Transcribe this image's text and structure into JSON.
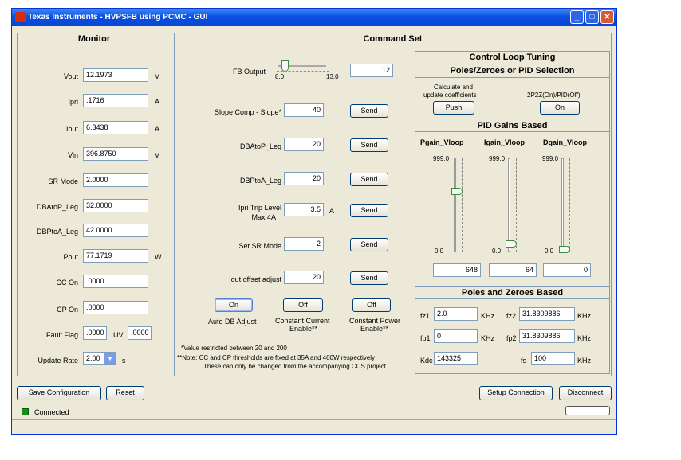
{
  "window": {
    "title": "Texas Instruments - HVPSFB using PCMC - GUI"
  },
  "monitor": {
    "title": "Monitor",
    "rows": [
      {
        "label": "Vout",
        "value": "12.1973",
        "unit": "V"
      },
      {
        "label": "Ipri",
        "value": ".1716",
        "unit": "A"
      },
      {
        "label": "Iout",
        "value": "6.3438",
        "unit": "A"
      },
      {
        "label": "Vin",
        "value": "396.8750",
        "unit": "V"
      },
      {
        "label": "SR Mode",
        "value": "2.0000",
        "unit": ""
      },
      {
        "label": "DBAtoP_Leg",
        "value": "32.0000",
        "unit": ""
      },
      {
        "label": "DBPtoA_Leg",
        "value": "42.0000",
        "unit": ""
      },
      {
        "label": "Pout",
        "value": "77.1719",
        "unit": "W"
      },
      {
        "label": "CC On",
        "value": ".0000",
        "unit": ""
      },
      {
        "label": "CP On",
        "value": ".0000",
        "unit": ""
      }
    ],
    "fault_flag": {
      "label": "Fault Flag",
      "value": ".0000",
      "uv_label": "UV",
      "uv_value": ".0000"
    },
    "update_rate": {
      "label": "Update Rate",
      "value": "2.00",
      "unit": "s"
    }
  },
  "command_set": {
    "title": "Command Set",
    "fb_output": {
      "label": "FB Output",
      "min": "8.0",
      "max": "13.0",
      "value": "12"
    },
    "slope_comp": {
      "label": "Slope Comp - Slope*",
      "value": "40",
      "button": "Send"
    },
    "dbatop_leg": {
      "label": "DBAtoP_Leg",
      "value": "20",
      "button": "Send"
    },
    "dbptoa_leg": {
      "label": "DBPtoA_Leg",
      "value": "20",
      "button": "Send"
    },
    "ipri_trip": {
      "label1": "Ipri Trip Level",
      "label2": "Max 4A",
      "value": "3.5",
      "unit": "A",
      "button": "Send"
    },
    "sr_mode": {
      "label": "Set SR Mode",
      "value": "2",
      "button": "Send"
    },
    "iout_offset": {
      "label": "Iout offset adjust",
      "value": "20",
      "button": "Send"
    },
    "toggles": [
      {
        "state": "On",
        "label1": "Auto DB Adjust",
        "label2": ""
      },
      {
        "state": "Off",
        "label1": "Constant Current",
        "label2": "Enable**"
      },
      {
        "state": "Off",
        "label1": "Constant Power",
        "label2": "Enable**"
      }
    ],
    "notes": [
      "*Value restricted between 20 and 200",
      "**Note: CC and CP thresholds are fixed  at 35A and 400W respectively",
      "These can only be changed from the accompanying CCS project."
    ]
  },
  "control_loop": {
    "title": "Control Loop Tuning",
    "selection_title": "Poles/Zeroes or PID Selection",
    "calc_label1": "Calculate and",
    "calc_label2": "update coefficients",
    "push_button": "Push",
    "mode_label": "2P2Z(On)/PID(Off)",
    "mode_button": "On",
    "pid_title": "PID Gains Based",
    "gains": [
      {
        "name": "Pgain_Vloop",
        "max": "999.0",
        "min": "0.0",
        "value": "648",
        "level": 0.648
      },
      {
        "name": "Igain_Vloop",
        "max": "999.0",
        "min": "0.0",
        "value": "64",
        "level": 0.064
      },
      {
        "name": "Dgain_Vloop",
        "max": "999.0",
        "min": "0.0",
        "value": "0",
        "level": 0.0
      }
    ],
    "pz_title": "Poles and Zeroes Based",
    "fz1": {
      "label": "fz1",
      "value": "2.0",
      "unit": "KHz"
    },
    "fz2": {
      "label": "fz2",
      "value": "31.8309886",
      "unit": "KHz"
    },
    "fp1": {
      "label": "fp1",
      "value": "0",
      "unit": "KHz"
    },
    "fp2": {
      "label": "fp2",
      "value": "31.8309886",
      "unit": "KHz"
    },
    "kdc": {
      "label": "Kdc",
      "value": "143325"
    },
    "fs": {
      "label": "fs",
      "value": "100",
      "unit": "KHz"
    }
  },
  "bottom": {
    "save_button": "Save Configuration",
    "reset_button": "Reset",
    "setup_button": "Setup Connection",
    "disconnect_button": "Disconnect",
    "status": "Connected"
  },
  "colors": {
    "title_bar": "#0a4ee0",
    "status_connected": "#1a8c1a",
    "face": "#ece9d8"
  }
}
